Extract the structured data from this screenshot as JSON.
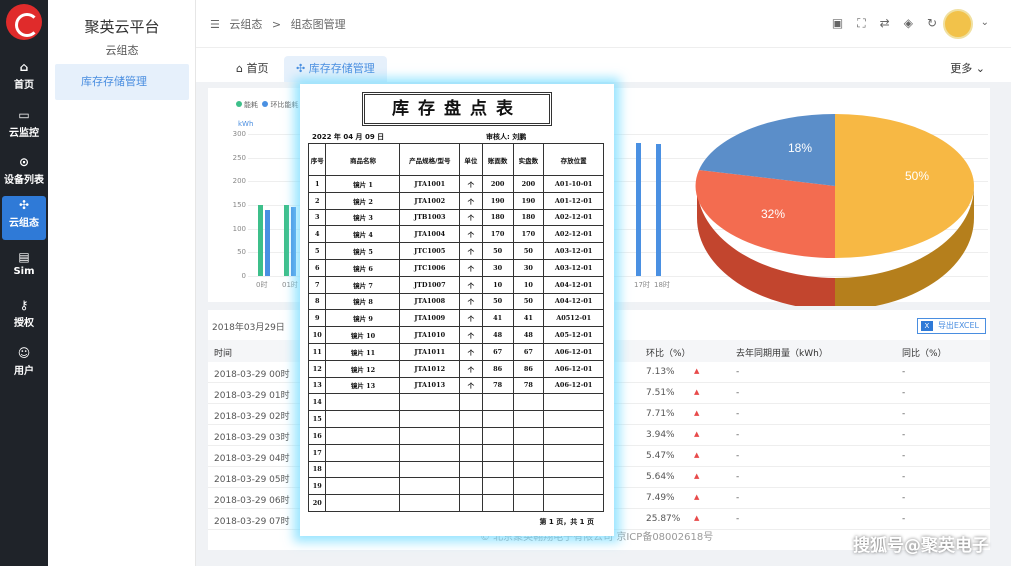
{
  "nav": {
    "items": [
      {
        "label": "首页",
        "icon": "home-icon"
      },
      {
        "label": "云监控",
        "icon": "monitor-icon"
      },
      {
        "label": "设备列表",
        "icon": "device-icon"
      },
      {
        "label": "云组态",
        "icon": "config-icon"
      },
      {
        "label": "Sim",
        "icon": "sim-icon"
      },
      {
        "label": "授权",
        "icon": "key-icon"
      },
      {
        "label": "用户",
        "icon": "user-icon"
      }
    ],
    "active": "云组态"
  },
  "sidebar": {
    "platform": "聚英云平台",
    "section": "云组态",
    "item": "库存存储管理"
  },
  "header": {
    "crumb_1": "云组态",
    "crumb_sep": ">",
    "crumb_2": "组态图管理"
  },
  "tabs": {
    "home": "首页",
    "active": "库存存储管理",
    "more": "更多"
  },
  "chart_data": [
    {
      "type": "bar",
      "legend": [
        "能耗",
        "环比能耗"
      ],
      "unit": "kWh",
      "ylim": [
        0,
        300
      ],
      "yticks": [
        "300",
        "250",
        "200",
        "150",
        "100",
        "50",
        "0"
      ],
      "categories": [
        "0时",
        "01时",
        "17时",
        "18时"
      ],
      "series": [
        {
          "name": "能耗",
          "color": "#3dbf8a",
          "values": [
            150,
            150
          ]
        },
        {
          "name": "环比能耗",
          "color": "#4a90e2",
          "values": [
            140,
            145,
            280,
            278
          ]
        }
      ]
    },
    {
      "type": "pie",
      "slices": [
        {
          "label": "50%",
          "value": 50,
          "color": "#f7b844"
        },
        {
          "label": "32%",
          "value": 32,
          "color": "#f36c50"
        },
        {
          "label": "18%",
          "value": 18,
          "color": "#5b8ec9"
        }
      ]
    }
  ],
  "table": {
    "date": "2018年03月29日",
    "export_label": "导出EXCEL",
    "columns": [
      "时间",
      "环比（%）",
      "去年同期用量（kWh）",
      "同比（%）"
    ],
    "rows": [
      {
        "time": "2018-03-29 00时",
        "mom": "7.13%",
        "last_year": "-",
        "yoy": "-"
      },
      {
        "time": "2018-03-29 01时",
        "mom": "7.51%",
        "last_year": "-",
        "yoy": "-"
      },
      {
        "time": "2018-03-29 02时",
        "mom": "7.71%",
        "last_year": "-",
        "yoy": "-"
      },
      {
        "time": "2018-03-29 03时",
        "mom": "3.94%",
        "last_year": "-",
        "yoy": "-"
      },
      {
        "time": "2018-03-29 04时",
        "mom": "5.47%",
        "last_year": "-",
        "yoy": "-"
      },
      {
        "time": "2018-03-29 05时",
        "mom": "5.64%",
        "last_year": "-",
        "yoy": "-"
      },
      {
        "time": "2018-03-29 06时",
        "mom": "7.49%",
        "last_year": "-",
        "yoy": "-"
      },
      {
        "time": "2018-03-29 07时",
        "mom": "25.87%",
        "last_year": "-",
        "yoy": "-"
      }
    ]
  },
  "footer": "© 北京聚英翱翔电子有限公司  京ICP备08002618号",
  "sheet": {
    "title": "库存盘点表",
    "date": "2022 年 04 月 09 日",
    "reviewer": "审核人: 刘鹏",
    "columns": [
      "序号",
      "商品名称",
      "产品规格/型号",
      "单位",
      "账面数",
      "实盘数",
      "存放位置"
    ],
    "rows": [
      [
        "1",
        "镜片 1",
        "JTA1001",
        "个",
        "200",
        "200",
        "A01-10-01"
      ],
      [
        "2",
        "镜片 2",
        "JTA1002",
        "个",
        "190",
        "190",
        "A01-12-01"
      ],
      [
        "3",
        "镜片 3",
        "JTB1003",
        "个",
        "180",
        "180",
        "A02-12-01"
      ],
      [
        "4",
        "镜片 4",
        "JTA1004",
        "个",
        "170",
        "170",
        "A02-12-01"
      ],
      [
        "5",
        "镜片 5",
        "JTC1005",
        "个",
        "50",
        "50",
        "A03-12-01"
      ],
      [
        "6",
        "镜片 6",
        "JTC1006",
        "个",
        "30",
        "30",
        "A03-12-01"
      ],
      [
        "7",
        "镜片 7",
        "JTD1007",
        "个",
        "10",
        "10",
        "A04-12-01"
      ],
      [
        "8",
        "镜片 8",
        "JTA1008",
        "个",
        "50",
        "50",
        "A04-12-01"
      ],
      [
        "9",
        "镜片 9",
        "JTA1009",
        "个",
        "41",
        "41",
        "A0512-01"
      ],
      [
        "10",
        "镜片 10",
        "JTA1010",
        "个",
        "48",
        "48",
        "A05-12-01"
      ],
      [
        "11",
        "镜片 11",
        "JTA1011",
        "个",
        "67",
        "67",
        "A06-12-01"
      ],
      [
        "12",
        "镜片 12",
        "JTA1012",
        "个",
        "86",
        "86",
        "A06-12-01"
      ],
      [
        "13",
        "镜片 13",
        "JTA1013",
        "个",
        "78",
        "78",
        "A06-12-01"
      ],
      [
        "14",
        "",
        "",
        "",
        "",
        "",
        ""
      ],
      [
        "15",
        "",
        "",
        "",
        "",
        "",
        ""
      ],
      [
        "16",
        "",
        "",
        "",
        "",
        "",
        ""
      ],
      [
        "17",
        "",
        "",
        "",
        "",
        "",
        ""
      ],
      [
        "18",
        "",
        "",
        "",
        "",
        "",
        ""
      ],
      [
        "19",
        "",
        "",
        "",
        "",
        "",
        ""
      ],
      [
        "20",
        "",
        "",
        "",
        "",
        "",
        ""
      ]
    ],
    "page": "第 1 页，共 1 页"
  },
  "watermark": "搜狐号@聚英电子"
}
